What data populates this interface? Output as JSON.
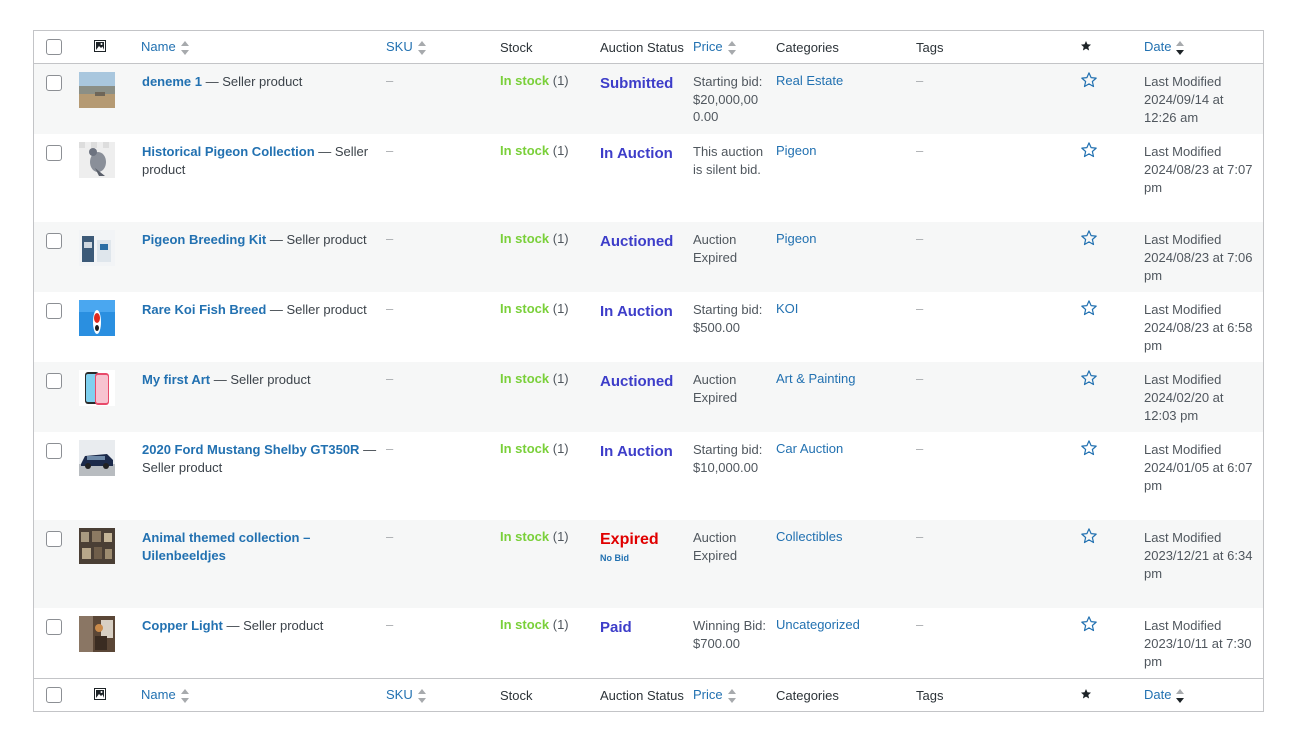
{
  "columns": {
    "name": "Name",
    "sku": "SKU",
    "stock": "Stock",
    "auction_status": "Auction Status",
    "price": "Price",
    "categories": "Categories",
    "tags": "Tags",
    "date": "Date"
  },
  "rows": [
    {
      "name": "deneme 1",
      "type": " — Seller product",
      "sku": "–",
      "stock": "In stock",
      "qty": " (1)",
      "status": "Submitted",
      "status_sub": "",
      "price": "Starting bid: $20,000,000.00",
      "category": "Real Estate",
      "tags": "–",
      "date_label": "Last Modified",
      "date": "2024/09/14 at 12:26 am"
    },
    {
      "name": "Historical Pigeon Collection",
      "type": " — Seller product",
      "sku": "–",
      "stock": "In stock",
      "qty": " (1)",
      "status": "In Auction",
      "status_sub": "",
      "price": "This auction is silent bid.",
      "category": "Pigeon",
      "tags": "–",
      "date_label": "Last Modified",
      "date": "2024/08/23 at 7:07 pm"
    },
    {
      "name": "Pigeon Breeding Kit",
      "type": " — Seller product",
      "sku": "–",
      "stock": "In stock",
      "qty": " (1)",
      "status": "Auctioned",
      "status_sub": "",
      "price": "Auction Expired",
      "category": "Pigeon",
      "tags": "–",
      "date_label": "Last Modified",
      "date": "2024/08/23 at 7:06 pm"
    },
    {
      "name": "Rare Koi Fish Breed",
      "type": " — Seller product",
      "sku": "–",
      "stock": "In stock",
      "qty": " (1)",
      "status": "In Auction",
      "status_sub": "",
      "price": "Starting bid: $500.00",
      "category": "KOI",
      "tags": "–",
      "date_label": "Last Modified",
      "date": "2024/08/23 at 6:58 pm"
    },
    {
      "name": "My first Art",
      "type": " — Seller product",
      "sku": "–",
      "stock": "In stock",
      "qty": " (1)",
      "status": "Auctioned",
      "status_sub": "",
      "price": "Auction Expired",
      "category": "Art & Painting",
      "tags": "–",
      "date_label": "Last Modified",
      "date": "2024/02/20 at 12:03 pm"
    },
    {
      "name": "2020 Ford Mustang Shelby GT350R",
      "type": " — Seller product",
      "sku": "–",
      "stock": "In stock",
      "qty": " (1)",
      "status": "In Auction",
      "status_sub": "",
      "price": "Starting bid: $10,000.00",
      "category": "Car Auction",
      "tags": "–",
      "date_label": "Last Modified",
      "date": "2024/01/05 at 6:07 pm"
    },
    {
      "name": "Animal themed collection – Uilenbeeldjes",
      "type": "",
      "sku": "–",
      "stock": "In stock",
      "qty": " (1)",
      "status": "Expired",
      "status_sub": "No Bid",
      "price": "Auction Expired",
      "category": "Collectibles",
      "tags": "–",
      "date_label": "Last Modified",
      "date": "2023/12/21 at 6:34 pm"
    },
    {
      "name": "Copper Light",
      "type": " — Seller product",
      "sku": "–",
      "stock": "In stock",
      "qty": " (1)",
      "status": "Paid",
      "status_sub": "",
      "price": "Winning Bid: $700.00",
      "category": "Uncategorized",
      "tags": "–",
      "date_label": "Last Modified",
      "date": "2023/10/11 at 7:30 pm"
    }
  ],
  "colors": {
    "link": "#2271b1",
    "in_stock": "#7ad03a",
    "status": "#3d3dc9",
    "expired": "#e00000"
  }
}
